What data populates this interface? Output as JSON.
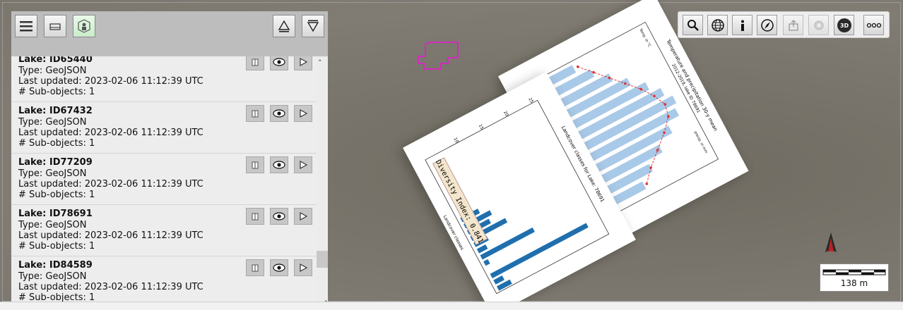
{
  "panel": {
    "items": [
      {
        "title": "Lake: ID65440",
        "type": "Type: GeoJSON",
        "updated": "Last updated: 2023-02-06 11:12:39 UTC",
        "subobjects": "# Sub-objects: 1"
      },
      {
        "title": "Lake: ID67432",
        "type": "Type: GeoJSON",
        "updated": "Last updated: 2023-02-06 11:12:39 UTC",
        "subobjects": "# Sub-objects: 1"
      },
      {
        "title": "Lake: ID77209",
        "type": "Type: GeoJSON",
        "updated": "Last updated: 2023-02-06 11:12:39 UTC",
        "subobjects": "# Sub-objects: 1"
      },
      {
        "title": "Lake: ID78691",
        "type": "Type: GeoJSON",
        "updated": "Last updated: 2023-02-06 11:12:39 UTC",
        "subobjects": "# Sub-objects: 1"
      },
      {
        "title": "Lake: ID84589",
        "type": "Type: GeoJSON",
        "updated": "Last updated: 2023-02-06 11:12:39 UTC",
        "subobjects": "# Sub-objects: 1"
      }
    ]
  },
  "toolbar": {
    "icons": [
      "search-icon",
      "globe-icon",
      "info-icon",
      "compass-icon",
      "share-icon",
      "settings-icon",
      "3d-icon",
      "more-icon"
    ],
    "btn_3d_label": "3D"
  },
  "scale": {
    "label": "138 m"
  },
  "landcover_chart": {
    "title": "Landcover classes for Lake: 78691",
    "xlabel": "Landcover classes",
    "ylabel": "n of classified Pixel",
    "yticks": [
      "25",
      "20",
      "15",
      "10"
    ],
    "diversity": "Diversity Index: 0.841"
  },
  "climate_chart": {
    "title": "Temperature and precipitation 30-y mean",
    "subtitle": "2012-2019, lake ID 78691",
    "legend_title": "Temperature",
    "legend_items": [
      "mean of temp. max",
      "mean of temp. min",
      "mean of mean temp."
    ],
    "legend2_items": [
      "Precipitation",
      "mean of mean precip"
    ],
    "temp_label": "Temp. in °C",
    "precip_label": "precip. in mm",
    "months": [
      "Jan",
      "Feb",
      "Mar",
      "Apr",
      "May",
      "Jun",
      "Jul",
      "Aug",
      "Sep",
      "Oct",
      "Nov",
      "Dec"
    ]
  },
  "colors": {
    "panel_header": "#bdbdbd",
    "panel_bg": "#ededed",
    "lake_outline": "#e020c8",
    "bar_dark": "#1f6fae",
    "bar_light": "#a9c9e8",
    "temp_point": "#e03030"
  }
}
